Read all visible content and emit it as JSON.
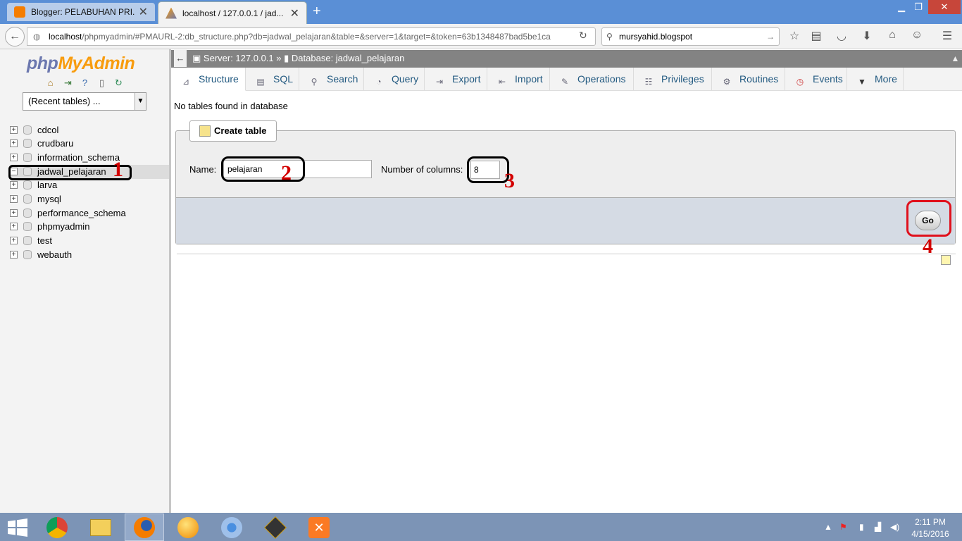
{
  "browser": {
    "tabs": [
      {
        "title": "Blogger: PELABUHAN PRI..."
      },
      {
        "title": "localhost / 127.0.0.1 / jad..."
      }
    ],
    "url_host": "localhost",
    "url_path": "/phpmyadmin/#PMAURL-2:db_structure.php?db=jadwal_pelajaran&table=&server=1&target=&token=63b1348487bad5be1ca",
    "search_value": "mursyahid.blogspot"
  },
  "sidebar": {
    "logo_a": "php",
    "logo_b": "MyAdmin",
    "recent": "(Recent tables) ...",
    "databases": [
      {
        "name": "cdcol"
      },
      {
        "name": "crudbaru"
      },
      {
        "name": "information_schema"
      },
      {
        "name": "jadwal_pelajaran",
        "selected": true
      },
      {
        "name": "larva"
      },
      {
        "name": "mysql"
      },
      {
        "name": "performance_schema"
      },
      {
        "name": "phpmyadmin"
      },
      {
        "name": "test"
      },
      {
        "name": "webauth"
      }
    ]
  },
  "breadcrumb": {
    "server": "Server: 127.0.0.1",
    "sep": "»",
    "database": "Database: jadwal_pelajaran"
  },
  "tabs": [
    {
      "label": "Structure",
      "icon": "structure-icon"
    },
    {
      "label": "SQL",
      "icon": "sql-icon"
    },
    {
      "label": "Search",
      "icon": "search-icon"
    },
    {
      "label": "Query",
      "icon": "query-icon"
    },
    {
      "label": "Export",
      "icon": "export-icon"
    },
    {
      "label": "Import",
      "icon": "import-icon"
    },
    {
      "label": "Operations",
      "icon": "wrench-icon"
    },
    {
      "label": "Privileges",
      "icon": "privileges-icon"
    },
    {
      "label": "Routines",
      "icon": "routines-icon"
    },
    {
      "label": "Events",
      "icon": "clock-icon"
    },
    {
      "label": "More",
      "icon": "triangle-down-icon"
    }
  ],
  "main": {
    "no_tables": "No tables found in database",
    "create_table": "Create table",
    "name_label": "Name:",
    "name_value": "pelajaran",
    "cols_label": "Number of columns:",
    "cols_value": "8",
    "go": "Go"
  },
  "annotations": [
    "1",
    "2",
    "3",
    "4"
  ],
  "clock": {
    "time": "2:11 PM",
    "date": "4/15/2016"
  },
  "colors": {
    "annotation_red": "#d30000",
    "pma_blue": "#6c78af",
    "pma_orange": "#f89c0e",
    "titlebar": "#5a8fd6",
    "taskbar": "#7c94b6"
  }
}
